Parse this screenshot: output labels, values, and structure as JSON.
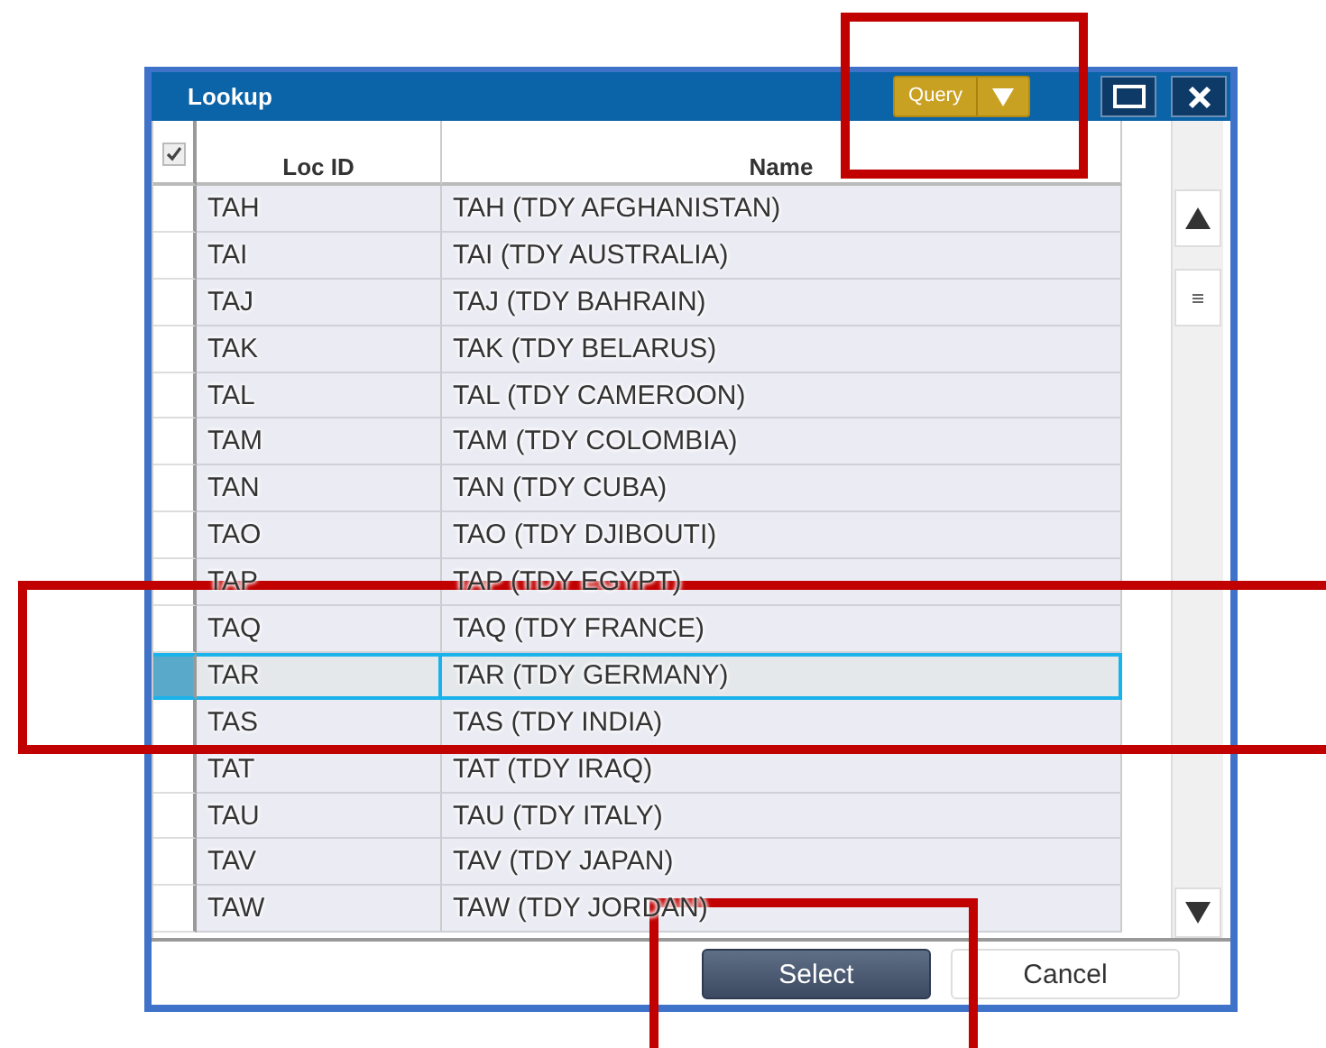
{
  "window": {
    "title": "Lookup"
  },
  "toolbar": {
    "query_button": "Query"
  },
  "table": {
    "header_checkbox": {
      "checked": true
    },
    "columns": [
      "Loc ID",
      "Name"
    ],
    "rows": [
      {
        "loc_id": "TAH",
        "name": "TAH (TDY AFGHANISTAN)",
        "selected": false
      },
      {
        "loc_id": "TAI",
        "name": "TAI (TDY AUSTRALIA)",
        "selected": false
      },
      {
        "loc_id": "TAJ",
        "name": "TAJ (TDY BAHRAIN)",
        "selected": false
      },
      {
        "loc_id": "TAK",
        "name": "TAK (TDY BELARUS)",
        "selected": false
      },
      {
        "loc_id": "TAL",
        "name": "TAL (TDY CAMEROON)",
        "selected": false
      },
      {
        "loc_id": "TAM",
        "name": "TAM (TDY COLOMBIA)",
        "selected": false
      },
      {
        "loc_id": "TAN",
        "name": "TAN (TDY CUBA)",
        "selected": false
      },
      {
        "loc_id": "TAO",
        "name": "TAO (TDY DJIBOUTI)",
        "selected": false
      },
      {
        "loc_id": "TAP",
        "name": "TAP (TDY EGYPT)",
        "selected": false
      },
      {
        "loc_id": "TAQ",
        "name": "TAQ (TDY FRANCE)",
        "selected": false
      },
      {
        "loc_id": "TAR",
        "name": "TAR (TDY GERMANY)",
        "selected": true
      },
      {
        "loc_id": "TAS",
        "name": "TAS (TDY INDIA)",
        "selected": false
      },
      {
        "loc_id": "TAT",
        "name": "TAT (TDY IRAQ)",
        "selected": false
      },
      {
        "loc_id": "TAU",
        "name": "TAU (TDY ITALY)",
        "selected": false
      },
      {
        "loc_id": "TAV",
        "name": "TAV (TDY JAPAN)",
        "selected": false
      },
      {
        "loc_id": "TAW",
        "name": "TAW (TDY JORDAN)",
        "selected": false
      }
    ]
  },
  "buttons": [
    "Select",
    "Cancel"
  ]
}
